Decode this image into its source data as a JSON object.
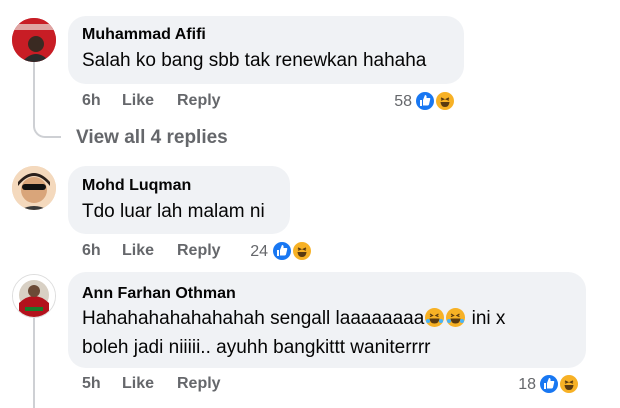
{
  "comments": [
    {
      "author": "Muhammad Afifi",
      "text": "Salah ko bang sbb tak renewkan hahaha",
      "time": "6h",
      "like_label": "Like",
      "reply_label": "Reply",
      "reaction_count": "58",
      "reactions": [
        "like-icon",
        "haha-icon"
      ]
    },
    {
      "author": "Mohd Luqman",
      "text": "Tdo luar lah malam ni",
      "time": "6h",
      "like_label": "Like",
      "reply_label": "Reply",
      "reaction_count": "24",
      "reactions": [
        "like-icon",
        "haha-icon"
      ]
    },
    {
      "author": "Ann Farhan Othman",
      "text_line1_before": "Hahahahahahahahah sengall laaaaaaaa",
      "text_line1_after": " ini x",
      "text_line2": "boleh jadi niiiii.. ayuhh bangkittt waniterrrr",
      "time": "5h",
      "like_label": "Like",
      "reply_label": "Reply",
      "reaction_count": "18",
      "reactions": [
        "like-icon",
        "haha-icon"
      ]
    }
  ],
  "view_replies_label": "View all 4 replies",
  "colors": {
    "bubble_bg": "#f0f2f5",
    "meta_text": "#65676b",
    "like_blue": "#1877f2",
    "haha_yellow": "#f7b125",
    "thread_line": "#ced0d4"
  }
}
